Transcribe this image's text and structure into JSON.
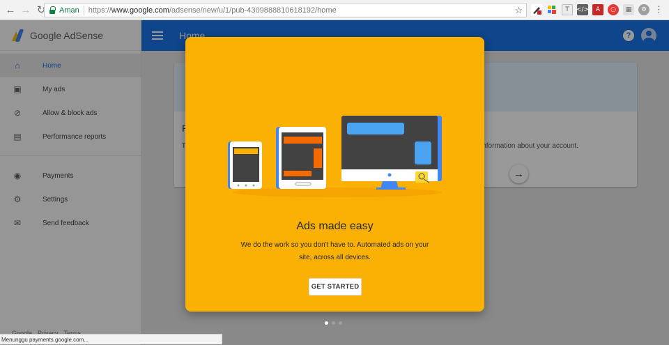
{
  "browser": {
    "secure_label": "Aman",
    "url_scheme": "https://",
    "url_host": "www.google.com",
    "url_path": "/adsense/new/u/1/pub-4309888810618192/home",
    "status_text": "Menunggu payments.google.com..."
  },
  "app": {
    "logo_text": "Google AdSense",
    "page_title": "Home",
    "footer": [
      "Google",
      "Privacy",
      "Terms"
    ]
  },
  "sidebar": {
    "items": [
      {
        "label": "Home",
        "icon": "home-icon"
      },
      {
        "label": "My ads",
        "icon": "ads-icon"
      },
      {
        "label": "Allow & block ads",
        "icon": "block-icon"
      },
      {
        "label": "Performance reports",
        "icon": "reports-icon"
      },
      {
        "label": "Payments",
        "icon": "payments-icon"
      },
      {
        "label": "Settings",
        "icon": "settings-icon"
      },
      {
        "label": "Send feedback",
        "icon": "feedback-icon"
      }
    ]
  },
  "background_card": {
    "title_letter": "P",
    "body_letter": "T",
    "body_text": "information about your account."
  },
  "dialog": {
    "title": "Ads made easy",
    "body": "We do the work so you don't have to. Automated ads on your site, across all devices.",
    "cta_label": "GET STARTED",
    "page_count": 3,
    "active_page": 1
  },
  "colors": {
    "brand_blue": "#1a73e8",
    "dialog_yellow": "#fbb103"
  }
}
